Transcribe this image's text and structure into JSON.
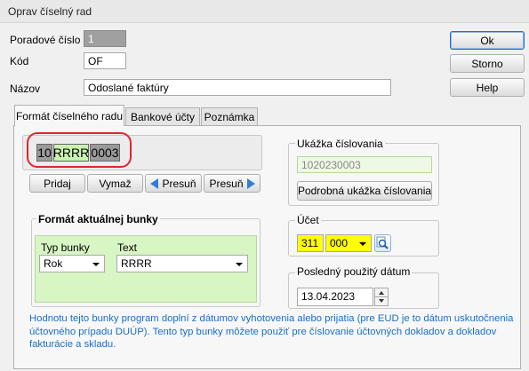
{
  "window": {
    "title": "Oprav číselný rad"
  },
  "form": {
    "poradove_cislo_label": "Poradové číslo",
    "poradove_cislo_value": "1",
    "kod_label": "Kód",
    "kod_value": "OF",
    "nazov_label": "Názov",
    "nazov_value": "Odoslané faktúry"
  },
  "buttons": {
    "ok": "Ok",
    "storno": "Storno",
    "help": "Help"
  },
  "tabs": [
    {
      "label": "Formát číselného radu"
    },
    {
      "label": "Bankové účty"
    },
    {
      "label": "Poznámka"
    }
  ],
  "format": {
    "cells": [
      "10",
      "RRRR",
      "0003"
    ],
    "pridaj": "Pridaj",
    "vymaz": "Vymaž",
    "presun_left": "Presuň",
    "presun_right": "Presuň",
    "highlight_color": "#e0252c"
  },
  "current_cell": {
    "title": "Formát aktuálnej bunky",
    "typ_label": "Typ bunky",
    "typ_value": "Rok",
    "text_label": "Text",
    "text_value": "RRRR"
  },
  "preview": {
    "title": "Ukážka číslovania",
    "value": "1020230003",
    "detail_button": "Podrobná ukážka číslovania"
  },
  "account": {
    "title": "Účet",
    "ucet": "311",
    "analytika": "000"
  },
  "last_date": {
    "title": "Posledný použitý dátum",
    "value": "13.04.2023"
  },
  "info_text": "Hodnotu tejto bunky program doplní z dátumov vyhotovenia alebo prijatia (pre EUD je to dátum uskutočnenia účtovného prípadu DUÚP). Tento typ bunky môžete použiť pre číslovanie účtovných dokladov a dokladov fakturácie a skladu.",
  "colors": {
    "info_text": "#1a6fc4",
    "green_panel": "#d8f5c4",
    "yellow_field": "#ffff00",
    "cell_gray": "#9a9a9a",
    "cell_green": "#c9f2b0"
  }
}
